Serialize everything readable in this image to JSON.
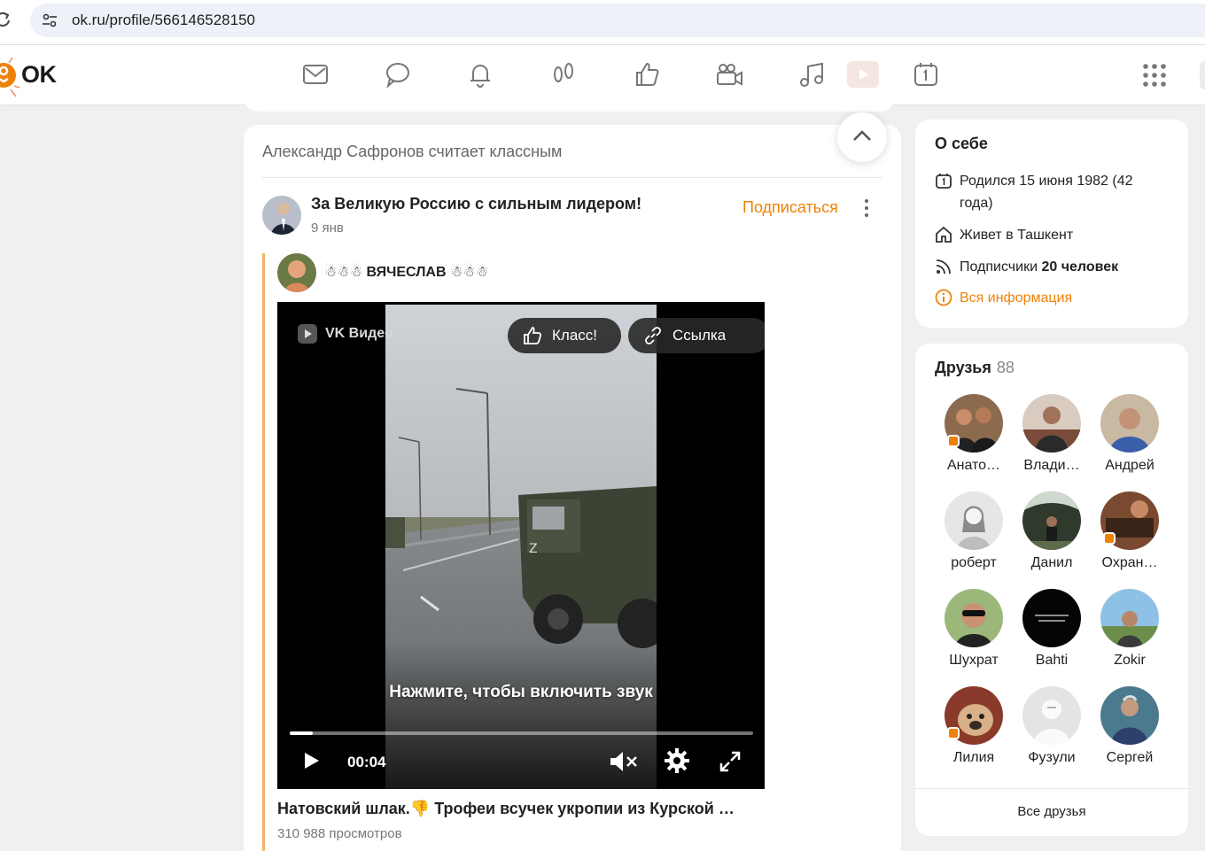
{
  "browser": {
    "url": "ok.ru/profile/566146528150"
  },
  "header": {
    "logo_text": "OK",
    "nav_icons": [
      "mail-icon",
      "chat-icon",
      "bell-icon",
      "guests-icon",
      "like-icon",
      "video-icon",
      "music-icon",
      "video-play-icon",
      "calendar-icon"
    ],
    "accent_color": "#ee8208"
  },
  "feed": {
    "caption": "Александр Сафронов считает классным",
    "post": {
      "group_name": "За Великую Россию с сильным лидером!",
      "date": "9 янв",
      "subscribe_label": "Подписаться",
      "author": "☃☃☃ ВЯЧЕСЛАВ ☃☃☃",
      "video": {
        "brand": "VK Видео",
        "like_label": "Класс!",
        "link_label": "Ссылка",
        "hint": "Нажмите, чтобы включить звук",
        "time": "00:04",
        "progress": 0.05
      },
      "title": "Натовский шлак.👎 Трофеи всучек укропии из Курской …",
      "views": "310 988 просмотров"
    }
  },
  "about": {
    "title": "О себе",
    "born": "Родился 15 июня 1982 (42 года)",
    "lives": "Живет в Ташкент",
    "followers_prefix": "Подписчики ",
    "followers_count": "20 человек",
    "all_info": "Вся информация"
  },
  "friends": {
    "title": "Друзья",
    "count": "88",
    "items": [
      {
        "name": "Анато…"
      },
      {
        "name": "Влади…"
      },
      {
        "name": "Андрей"
      },
      {
        "name": "роберт"
      },
      {
        "name": "Данил"
      },
      {
        "name": "Охран…"
      },
      {
        "name": "Шухрат"
      },
      {
        "name": "Bahti"
      },
      {
        "name": "Zokir"
      },
      {
        "name": "Лилия"
      },
      {
        "name": "Фузули"
      },
      {
        "name": "Сергей"
      }
    ],
    "all_label": "Все друзья"
  }
}
